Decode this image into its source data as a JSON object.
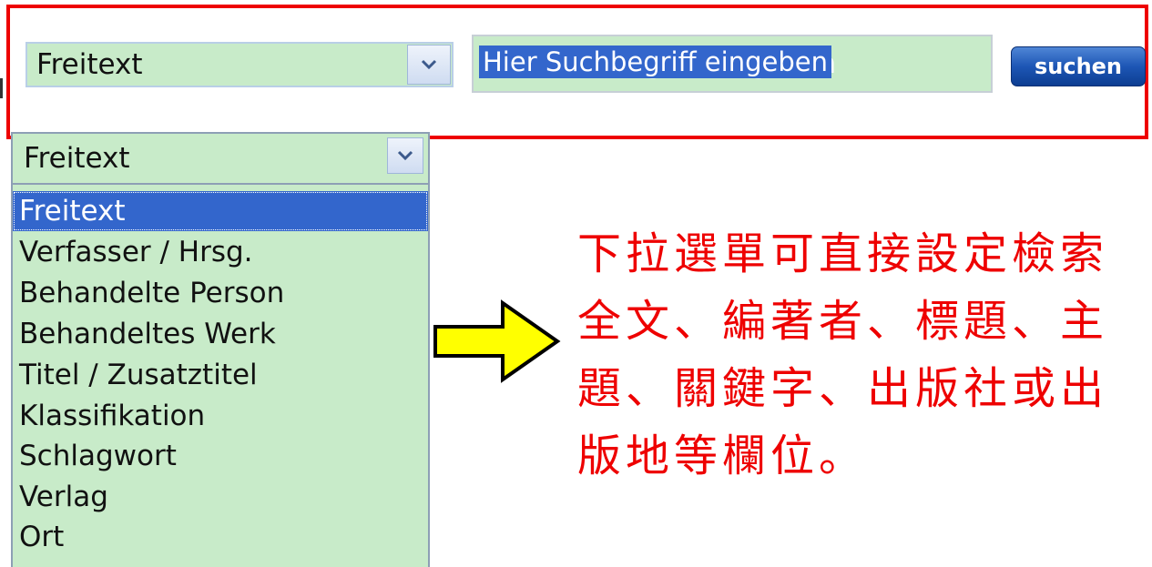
{
  "search_bar": {
    "field_select": {
      "value": "Freitext"
    },
    "search_input": {
      "value": "Hier Suchbegriff eingeben"
    },
    "search_button": {
      "label": "suchen"
    }
  },
  "dropdown": {
    "value": "Freitext",
    "options": [
      "Freitext",
      "Verfasser / Hrsg.",
      "Behandelte Person",
      "Behandeltes Werk",
      "Titel / Zusatztitel",
      "Klassifikation",
      "Schlagwort",
      "Verlag",
      "Ort"
    ],
    "selected_option": "Freitext"
  },
  "annotation": {
    "arrow_icon": "right-arrow-icon",
    "note_lines": [
      "下拉選單可直接設定檢索",
      "全文、編著者、標題、主",
      "題、關鍵字、出版社或出",
      "版地等欄位。"
    ]
  },
  "colors": {
    "highlight_border": "#ee0000",
    "field_background": "#c8ebc9",
    "selection": "#3366cc",
    "button": "#1d56b5",
    "arrow_fill": "#ffff00",
    "note_text": "#ee0000"
  }
}
